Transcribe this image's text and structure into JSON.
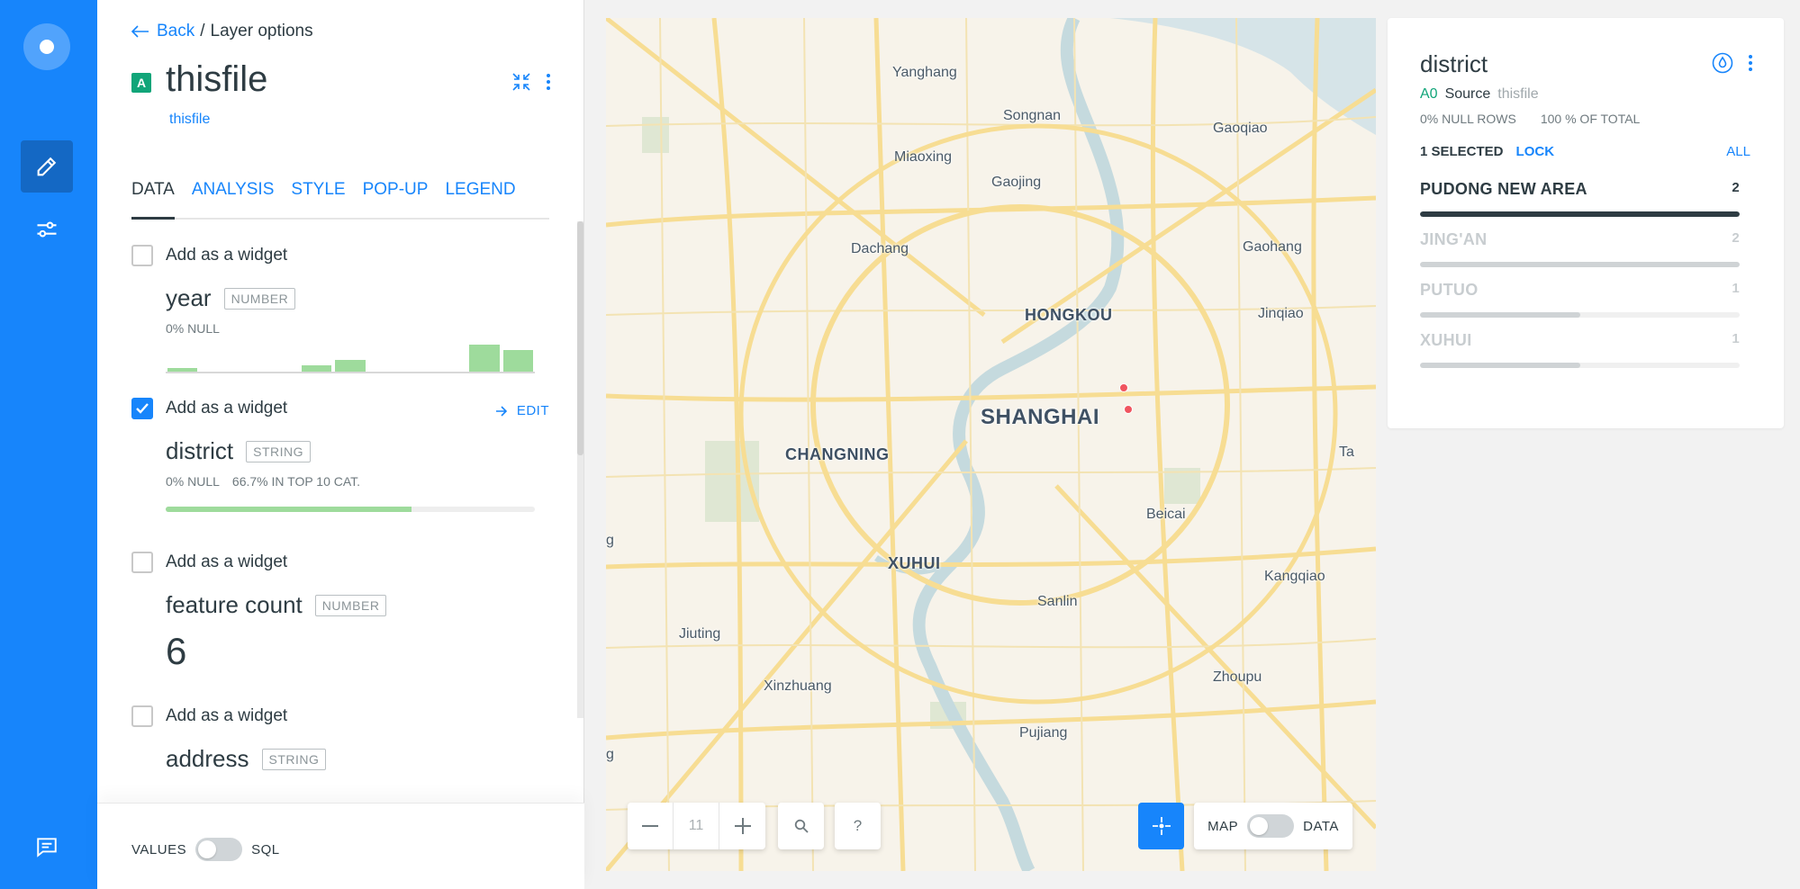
{
  "rail": {
    "icons": [
      "logo-icon",
      "pencil-icon",
      "sliders-icon",
      "chat-icon"
    ]
  },
  "breadcrumb": {
    "back": "Back",
    "separator": "/",
    "current": "Layer options"
  },
  "layer": {
    "badge": "A",
    "title": "thisfile",
    "source": "thisfile"
  },
  "tabs": [
    {
      "label": "DATA",
      "active": true
    },
    {
      "label": "ANALYSIS",
      "active": false
    },
    {
      "label": "STYLE",
      "active": false
    },
    {
      "label": "POP-UP",
      "active": false
    },
    {
      "label": "LEGEND",
      "active": false
    }
  ],
  "fields": [
    {
      "checkbox_label": "Add as a widget",
      "checked": false,
      "name": "year",
      "type": "NUMBER",
      "stats": [
        "0% NULL"
      ],
      "histogram": [
        0.15,
        0,
        0,
        0,
        0.25,
        0.45,
        0,
        0,
        0,
        1.0,
        0.8
      ]
    },
    {
      "checkbox_label": "Add as a widget",
      "checked": true,
      "edit_label": "EDIT",
      "name": "district",
      "type": "STRING",
      "stats": [
        "0% NULL",
        "66.7% IN TOP 10 CAT."
      ],
      "category_fill": 0.667
    },
    {
      "checkbox_label": "Add as a widget",
      "checked": false,
      "name": "feature count",
      "type": "NUMBER",
      "value": "6"
    },
    {
      "checkbox_label": "Add as a widget",
      "checked": false,
      "name": "address",
      "type": "STRING"
    }
  ],
  "footer": {
    "left_label": "VALUES",
    "right_label": "SQL"
  },
  "map": {
    "places": [
      {
        "name": "Yanghang",
        "kind": "town"
      },
      {
        "name": "Songnan",
        "kind": "town"
      },
      {
        "name": "Gaoqiao",
        "kind": "town"
      },
      {
        "name": "Miaoxing",
        "kind": "town"
      },
      {
        "name": "Gaojing",
        "kind": "town"
      },
      {
        "name": "Dachang",
        "kind": "town"
      },
      {
        "name": "Gaohang",
        "kind": "town"
      },
      {
        "name": "HONGKOU",
        "kind": "dist"
      },
      {
        "name": "Jinqiao",
        "kind": "town"
      },
      {
        "name": "SHANGHAI",
        "kind": "city"
      },
      {
        "name": "CHANGNING",
        "kind": "dist"
      },
      {
        "name": "Ta",
        "kind": "town"
      },
      {
        "name": "Beicai",
        "kind": "town"
      },
      {
        "name": "XUHUI",
        "kind": "dist"
      },
      {
        "name": "Kangqiao",
        "kind": "town"
      },
      {
        "name": "g",
        "kind": "town"
      },
      {
        "name": "Sanlin",
        "kind": "town"
      },
      {
        "name": "Jiuting",
        "kind": "town"
      },
      {
        "name": "Zhoupu",
        "kind": "town"
      },
      {
        "name": "Xinzhuang",
        "kind": "town"
      },
      {
        "name": "Pujiang",
        "kind": "town"
      },
      {
        "name": "g",
        "kind": "town"
      }
    ],
    "zoom_level": "11",
    "toggle_left": "MAP",
    "toggle_right": "DATA",
    "help_label": "?"
  },
  "widget": {
    "title": "district",
    "layer_badge": "A0",
    "source_label": "Source",
    "source_name": "thisfile",
    "null_rows": "0% NULL ROWS",
    "total": "100 % OF TOTAL",
    "selected": "1 SELECTED",
    "lock": "LOCK",
    "all": "ALL",
    "categories": [
      {
        "name": "PUDONG NEW AREA",
        "count": "2",
        "fraction": 1.0,
        "selected": true
      },
      {
        "name": "JING'AN",
        "count": "2",
        "fraction": 1.0,
        "selected": false
      },
      {
        "name": "PUTUO",
        "count": "1",
        "fraction": 0.5,
        "selected": false
      },
      {
        "name": "XUHUI",
        "count": "1",
        "fraction": 0.5,
        "selected": false
      }
    ]
  },
  "colors": {
    "accent": "#1785fb",
    "layer_green": "#11a579",
    "histogram": "#9edb9c",
    "text": "#2e3c43",
    "point": "#f0545f"
  }
}
